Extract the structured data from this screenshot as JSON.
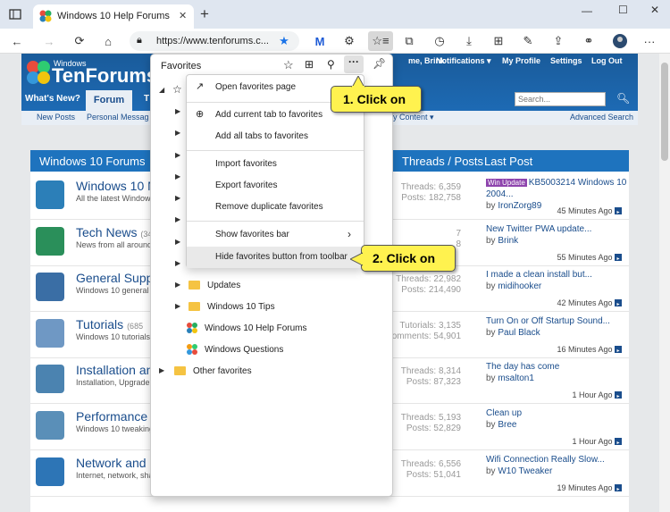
{
  "browser": {
    "tab_title": "Windows 10 Help Forums",
    "new_tab": "+",
    "window_controls": {
      "minimize": "—",
      "maximize": "☐",
      "close": "✕"
    },
    "url": "https://www.tenforums.c..."
  },
  "site": {
    "logo_small": "Windows",
    "logo_big": "TenForums",
    "user_nav": [
      "me, Brink",
      "Notifications ▾",
      "My Profile",
      "Settings",
      "Log Out"
    ],
    "nav": {
      "whats_new": "What's New?",
      "forum": "Forum",
      "cut": "T"
    },
    "search_placeholder": "Search...",
    "subnav": [
      "New Posts",
      "Personal Messag"
    ],
    "subnav_right": "y Content ▾",
    "advanced_search": "Advanced Search",
    "forum_header": "Windows 10 Forums",
    "threads_posts_header": "Threads / Posts",
    "last_post_header": "Last Post",
    "forums": [
      {
        "title": "Windows 10 N",
        "desc": "All the latest Window",
        "threads": "Threads: 6,359",
        "posts": "Posts: 182,758",
        "badge": "Win Update",
        "lp_title": "KB5003214 Windows 10 2004...",
        "lp_by": "IronZorg89",
        "lp_ago": "45 Minutes Ago",
        "icon_color": "#2c7fb8"
      },
      {
        "title": "Tech News",
        "title_suffix": "(34",
        "desc": "News from all around",
        "threads": "7",
        "posts": "8",
        "lp_title": "New Twitter PWA update...",
        "lp_by": "Brink",
        "lp_ago": "55 Minutes Ago",
        "icon_color": "#2a8f5a"
      },
      {
        "title": "General Supp",
        "desc": "Windows 10 general",
        "threads": "Threads: 22,982",
        "posts": "Posts: 214,490",
        "lp_title": "I made a clean install but...",
        "lp_by": "midihooker",
        "lp_ago": "42 Minutes Ago",
        "icon_color": "#3a6ea5"
      },
      {
        "title": "Tutorials",
        "title_suffix": "(685",
        "desc": "Windows 10 tutorials",
        "threads": "Tutorials: 3,135",
        "posts": "omments: 54,901",
        "lp_title": "Turn On or Off Startup Sound...",
        "lp_by": "Paul Black",
        "lp_ago": "16 Minutes Ago",
        "icon_color": "#6f98c4"
      },
      {
        "title": "Installation an",
        "desc": "Installation, Upgrade",
        "threads": "Threads: 8,314",
        "posts": "Posts: 87,323",
        "lp_title": "The day has come",
        "lp_by": "msalton1",
        "lp_ago": "1 Hour Ago",
        "icon_color": "#4b83b0"
      },
      {
        "title": "Performance",
        "desc": "Windows 10 tweaking",
        "threads": "Threads: 5,193",
        "posts": "Posts: 52,829",
        "lp_title": "Clean up",
        "lp_by": "Bree",
        "lp_ago": "1 Hour Ago",
        "icon_color": "#5a8fb8"
      },
      {
        "title": "Network and",
        "desc": "Internet, network, sha",
        "threads": "Threads: 6,556",
        "posts": "Posts: 51,041",
        "lp_title": "Wifi Connection Really Slow...",
        "lp_by": "W10 Tweaker",
        "lp_ago": "19 Minutes Ago",
        "icon_color": "#2d75b6"
      }
    ]
  },
  "favorites": {
    "title": "Favorites",
    "menu": {
      "open_page": "Open favorites page",
      "add_current": "Add current tab to favorites",
      "add_all": "Add all tabs to favorites",
      "import": "Import favorites",
      "export": "Export favorites",
      "remove_dup": "Remove duplicate favorites",
      "show_bar": "Show favorites bar",
      "hide_button": "Hide favorites button from toolbar"
    },
    "items": {
      "updates": "Updates",
      "tips": "Windows 10 Tips",
      "help_forums": "Windows 10 Help Forums",
      "questions": "Windows Questions",
      "other": "Other favorites"
    }
  },
  "callouts": {
    "one": "1. Click on",
    "two": "2. Click on"
  },
  "by_prefix": "by "
}
